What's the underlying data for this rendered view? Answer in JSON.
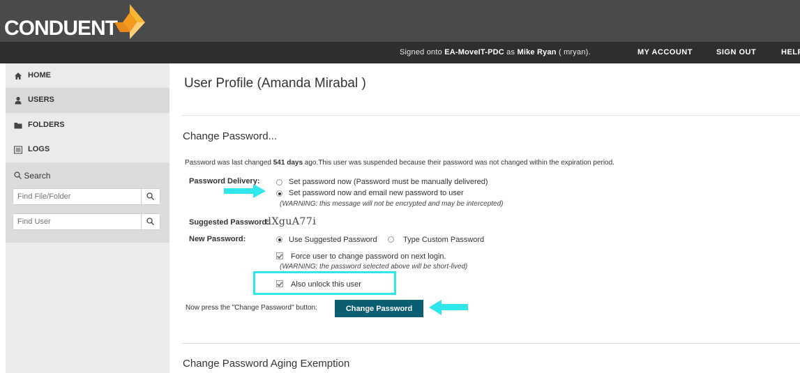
{
  "header": {
    "logo_text": "CONDUENT",
    "signed_prefix": "Signed onto",
    "server": "EA-MoveIT-PDC",
    "as_word": "as",
    "user_name": "Mike Ryan",
    "user_id": "( mryan).",
    "nav": [
      "MY ACCOUNT",
      "SIGN OUT",
      "HELP"
    ]
  },
  "sidebar": {
    "items": [
      {
        "label": "HOME",
        "icon": "home-icon"
      },
      {
        "label": "USERS",
        "icon": "user-icon"
      },
      {
        "label": "FOLDERS",
        "icon": "folder-icon"
      },
      {
        "label": "LOGS",
        "icon": "list-icon"
      }
    ],
    "search_label": "Search",
    "find_file_placeholder": "Find File/Folder",
    "find_user_placeholder": "Find User"
  },
  "main": {
    "title": "User Profile (Amanda Mirabal )",
    "section_title": "Change Password...",
    "info_prefix": "Password was last changed",
    "info_days": "541 days",
    "info_suffix": "ago.This user was suspended because their password was not changed within the expiration period.",
    "delivery_label": "Password Delivery:",
    "delivery_opt1": "Set password now (Password must be manually delivered)",
    "delivery_opt2": "Set password now and email new password to user",
    "delivery_warning": "(WARNING: this message will not be encrypted and may be intercepted)",
    "suggested_label": "Suggested Password:",
    "suggested_value": "dXguA77i",
    "new_password_label": "New Password:",
    "use_suggested": "Use Suggested Password",
    "type_custom": "Type Custom Password",
    "force_change": "Force user to change password on next login.",
    "force_warning": "(WARNING: the password selected above will be short-lived)",
    "unlock": "Also unlock this user",
    "press_text": "Now press the \"Change Password\" button:",
    "button_label": "Change Password",
    "aging_title": "Change Password Aging Exemption"
  },
  "colors": {
    "header_bg": "#4a4a4a",
    "nav_bg": "#2e2e2e",
    "button_bg": "#0b5d72",
    "highlight": "#2fe6ea",
    "logo_orange": "#f39a1f"
  }
}
